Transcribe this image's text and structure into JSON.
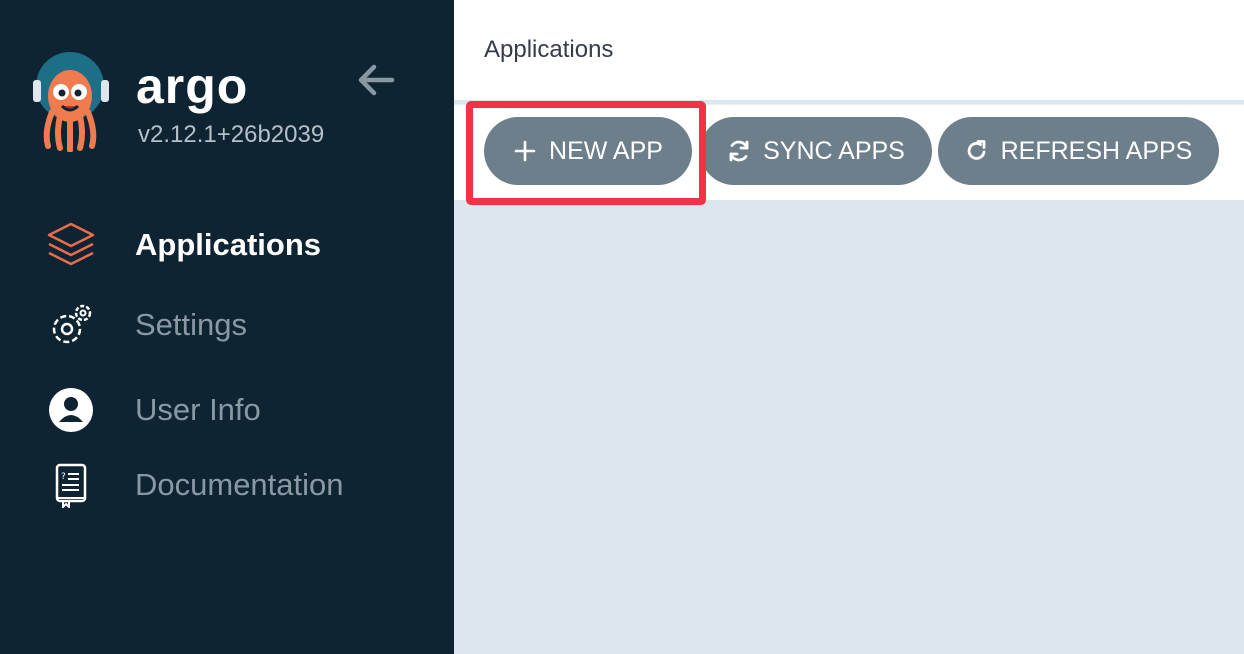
{
  "sidebar": {
    "brand": "argo",
    "version": "v2.12.1+26b2039",
    "items": [
      {
        "label": "Applications",
        "icon": "layers-icon",
        "active": true
      },
      {
        "label": "Settings",
        "icon": "gears-icon",
        "active": false
      },
      {
        "label": "User Info",
        "icon": "user-circle-icon",
        "active": false
      },
      {
        "label": "Documentation",
        "icon": "book-icon",
        "active": false
      }
    ]
  },
  "header": {
    "title": "Applications"
  },
  "toolbar": {
    "new_app": "NEW APP",
    "sync_apps": "SYNC APPS",
    "refresh_apps": "REFRESH APPS"
  },
  "colors": {
    "sidebar_bg": "#0e2433",
    "accent_orange": "#e96d4c",
    "button_bg": "#6d7f8b",
    "highlight": "#f23345",
    "content_bg": "#dee6ed"
  }
}
